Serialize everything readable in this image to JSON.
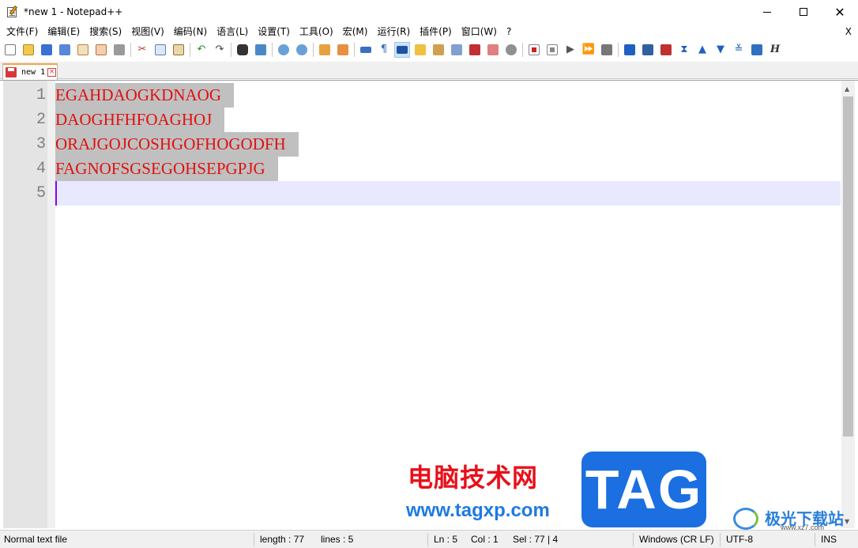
{
  "window": {
    "title": "*new 1 - Notepad++",
    "minimize_icon": "minimize-icon",
    "maximize_icon": "maximize-icon",
    "close_glyph": "✕"
  },
  "menu": {
    "items": [
      "文件(F)",
      "编辑(E)",
      "搜索(S)",
      "视图(V)",
      "编码(N)",
      "语言(L)",
      "设置(T)",
      "工具(O)",
      "宏(M)",
      "运行(R)",
      "插件(P)",
      "窗口(W)",
      "?"
    ],
    "close_label": "X"
  },
  "toolbar": {
    "icons": [
      "new-file-icon",
      "open-file-icon",
      "save-icon",
      "save-all-icon",
      "close-icon",
      "close-all-icon",
      "print-icon",
      "cut-icon",
      "copy-icon",
      "paste-icon",
      "undo-icon",
      "redo-icon",
      "find-icon",
      "replace-icon",
      "zoom-in-icon",
      "zoom-out-icon",
      "sync-vertical-icon",
      "sync-horizontal-icon",
      "word-wrap-icon",
      "show-all-chars-icon",
      "indent-guide-icon",
      "user-language-icon",
      "doc-map-icon",
      "doc-list-icon",
      "function-list-icon",
      "folder-workspace-icon",
      "monitoring-icon",
      "record-macro-icon",
      "stop-record-icon",
      "play-macro-icon",
      "run-macro-multiple-icon",
      "save-macro-icon",
      "bookmark-icon",
      "compare-icon",
      "compare-2-icon",
      "collapse-icon",
      "previous-icon",
      "next-icon",
      "first-icon",
      "last-icon",
      "help-icon"
    ],
    "accent": "#4a90d9"
  },
  "tab": {
    "label": "new 1",
    "save_icon": "unsaved-file-icon",
    "close_icon": "tab-close-icon",
    "close_glyph": "×"
  },
  "editor": {
    "line_numbers": [
      "1",
      "2",
      "3",
      "4",
      "5"
    ],
    "lines": [
      "EGAHDAOGKDNAOG",
      "DAOGHFHFOAGHOJ",
      "ORAJGOJCOSHGOFHOGODFH",
      "FAGNOFSGSEGOHSEPGPJG",
      ""
    ],
    "text_color": "#e01010",
    "selection_color": "#c0c0c0",
    "current_line_color": "#e8e8ff"
  },
  "watermark": {
    "cn_text": "电脑技术网",
    "url": "www.tagxp.com",
    "tag": "TAG",
    "corner_cn": "极光下载站",
    "corner_en": "www.xz7.com"
  },
  "status": {
    "file_type": "Normal text file",
    "length": "length : 77",
    "lines": "lines : 5",
    "ln": "Ln : 5",
    "col": "Col : 1",
    "sel": "Sel : 77 | 4",
    "eol": "Windows (CR LF)",
    "encoding": "UTF-8",
    "mode": "INS"
  }
}
